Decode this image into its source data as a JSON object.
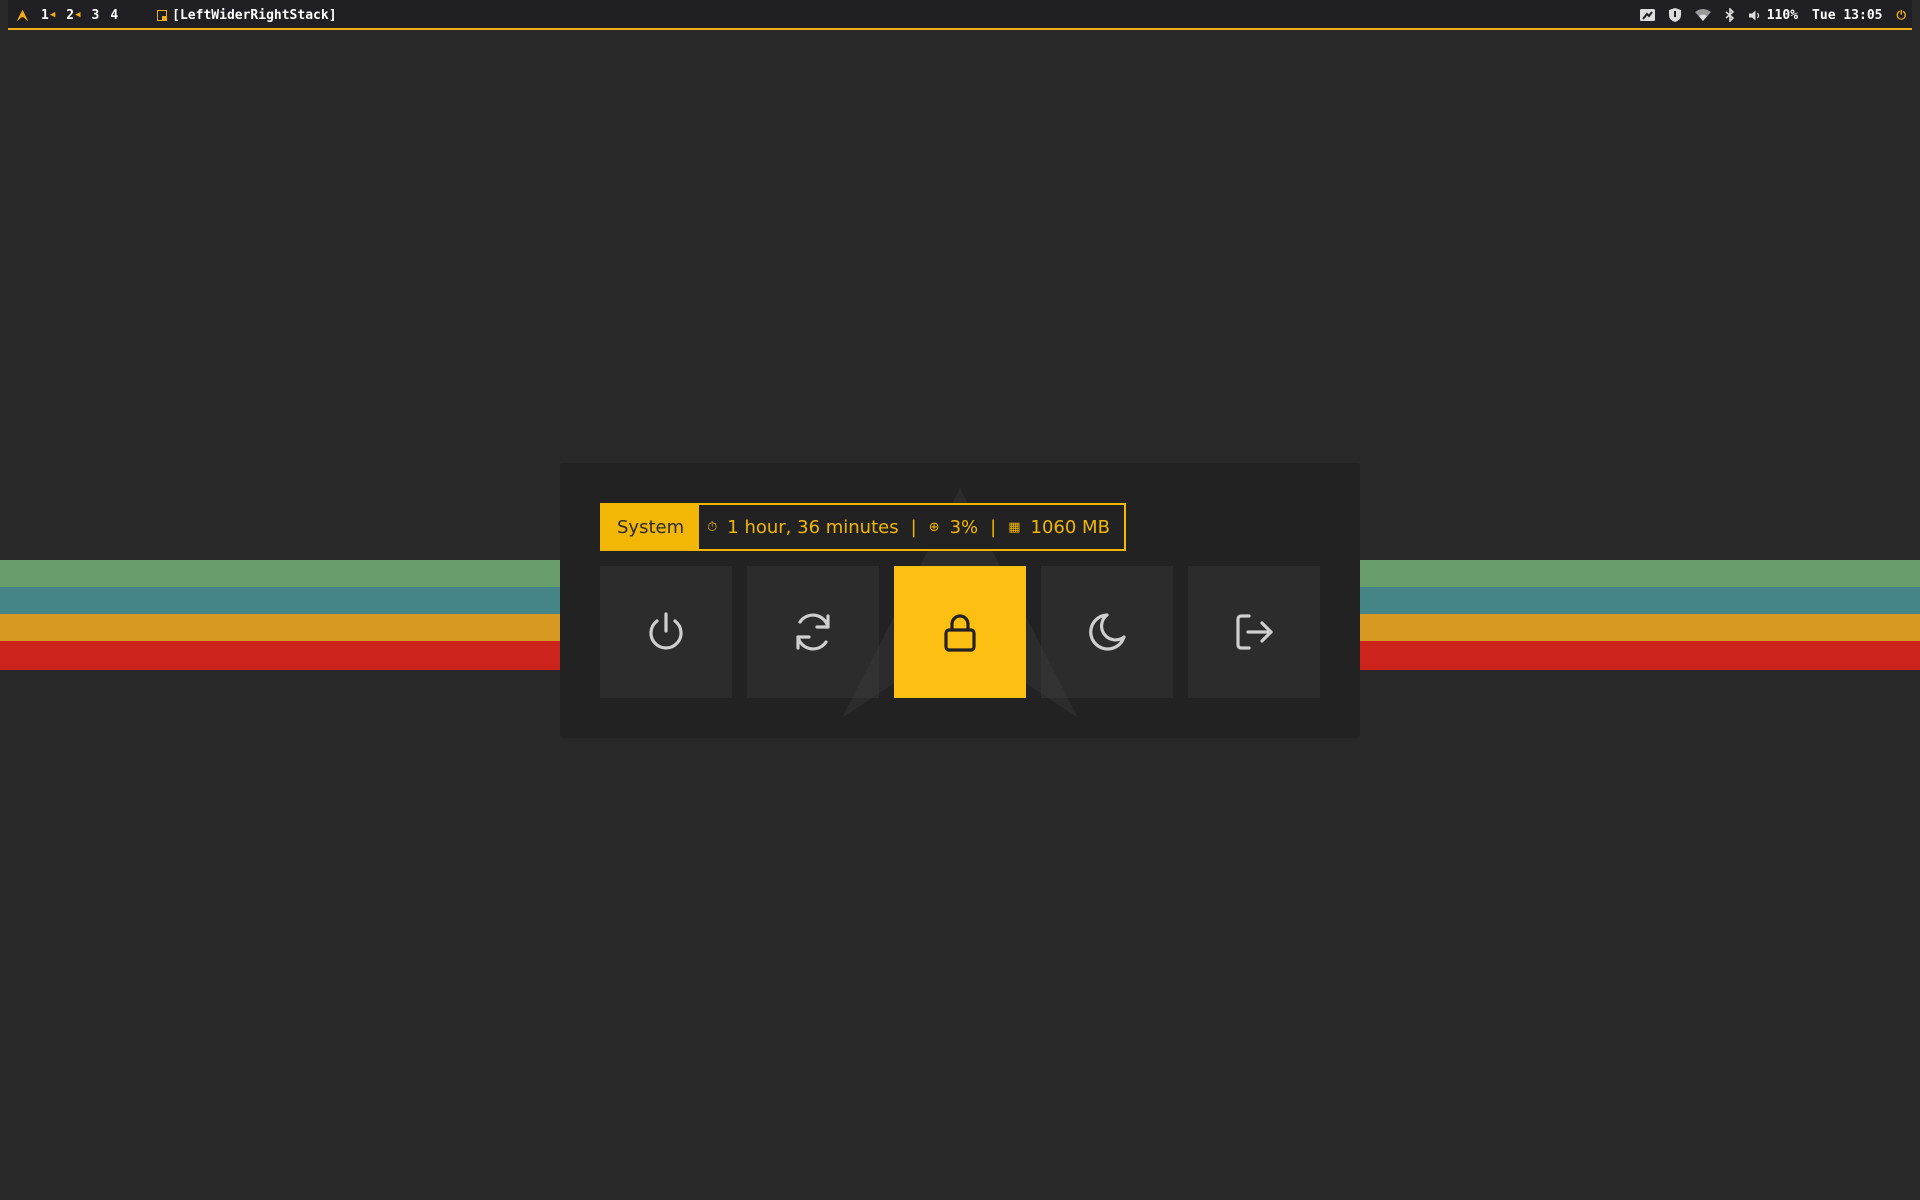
{
  "topbar": {
    "logo": "arch-logo-icon",
    "workspaces": [
      {
        "label": "1",
        "has_windows": true
      },
      {
        "label": "2",
        "has_windows": true
      },
      {
        "label": "3",
        "has_windows": false
      },
      {
        "label": "4",
        "has_windows": false
      }
    ],
    "layout": "[LeftWiderRightStack]",
    "tray_icons": [
      "screenshot-icon",
      "vpn-shield-icon",
      "wifi-icon",
      "bluetooth-icon"
    ],
    "volume": "110%",
    "clock": "Tue 13:05",
    "power_icon": "power-icon",
    "accent_color": "#f2ad16"
  },
  "stripes": [
    {
      "color": "#689d6a"
    },
    {
      "color": "#458588"
    },
    {
      "color": "#d79921"
    },
    {
      "color": "#cc241d"
    }
  ],
  "power_menu": {
    "label": "System",
    "uptime": "1 hour, 36 minutes",
    "cpu": "3%",
    "memory": "1060 MB",
    "separator": "|",
    "buttons": [
      {
        "name": "shutdown",
        "icon": "power-icon",
        "active": false
      },
      {
        "name": "reboot",
        "icon": "refresh-icon",
        "active": false
      },
      {
        "name": "lock",
        "icon": "lock-icon",
        "active": true
      },
      {
        "name": "suspend",
        "icon": "moon-icon",
        "active": false
      },
      {
        "name": "logout",
        "icon": "logout-icon",
        "active": false
      }
    ],
    "accent_color": "#fdbf12"
  }
}
